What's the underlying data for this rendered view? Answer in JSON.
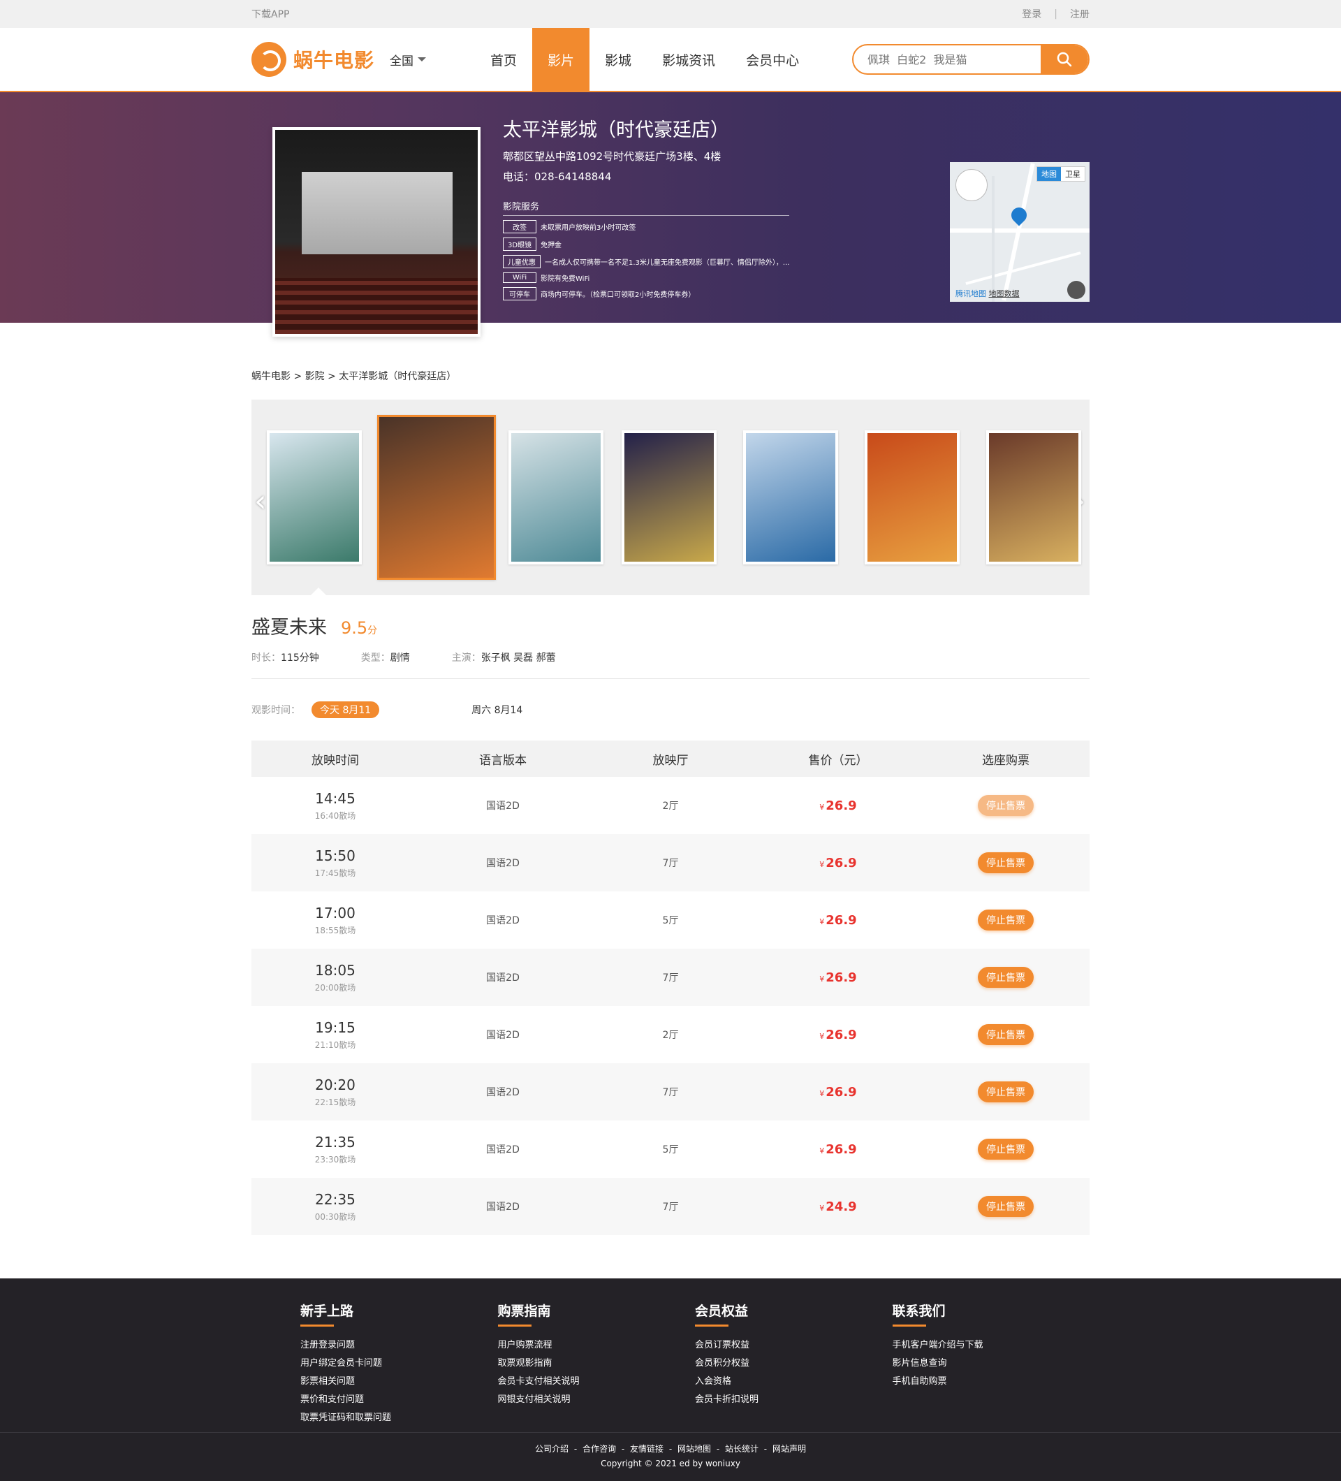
{
  "topbar": {
    "app": "下载APP",
    "login": "登录",
    "sep": "|",
    "register": "注册"
  },
  "header": {
    "logo": "蜗牛电影",
    "city": "全国",
    "nav": [
      "首页",
      "影片",
      "影城",
      "影城资讯",
      "会员中心"
    ],
    "nav_active": 1,
    "search_placeholder": "佩琪  白蛇2  我是猫"
  },
  "cinema": {
    "name": "太平洋影城（时代豪廷店）",
    "address": "郫都区望丛中路1092号时代豪廷广场3楼、4楼",
    "tel": "电话：028-64148844",
    "service_title": "影院服务",
    "services": [
      {
        "tag": "改签",
        "text": "未取票用户放映前3小时可改签"
      },
      {
        "tag": "3D眼镜",
        "text": "免押金"
      },
      {
        "tag": "儿童优惠",
        "text": "一名成人仅可携带一名不足1.3米儿童无座免费观影（巨幕厅、情侣厅除外），..."
      },
      {
        "tag": "WiFi",
        "text": "影院有免费WiFi"
      },
      {
        "tag": "可停车",
        "text": "商场内可停车。（检票口可领取2小时免费停车券）"
      }
    ],
    "map": {
      "tab_map": "地图",
      "tab_sat": "卫星",
      "brand": "腾讯地图",
      "data": "地图数据"
    }
  },
  "breadcrumb": "蜗牛电影 > 影院 > 太平洋影城（时代豪廷店）",
  "posters": {
    "count": 7,
    "selected": 1,
    "colors": [
      [
        "#d8e6ee",
        "#3b7a6a"
      ],
      [
        "#4a3328",
        "#e07a30"
      ],
      [
        "#d6e2e6",
        "#4e8a96"
      ],
      [
        "#23214a",
        "#c8a84a"
      ],
      [
        "#c2d6ea",
        "#2a6aa6"
      ],
      [
        "#c84a1a",
        "#e8a040"
      ],
      [
        "#6a3a2a",
        "#d8b060"
      ]
    ]
  },
  "movie": {
    "title": "盛夏未来",
    "score": "9.5",
    "score_unit": "分",
    "duration_label": "时长：",
    "duration": "115分钟",
    "genre_label": "类型：",
    "genre": "剧情",
    "cast_label": "主演：",
    "cast": "张子枫 吴磊 郝蕾"
  },
  "dates": {
    "label": "观影时间：",
    "today": "今天 8月11",
    "other": "周六 8月14"
  },
  "table": {
    "headers": [
      "放映时间",
      "语言版本",
      "放映厅",
      "售价（元）",
      "选座购票"
    ],
    "currency": "¥",
    "rows": [
      {
        "time": "14:45",
        "end": "16:40散场",
        "lang": "国语2D",
        "hall": "2厅",
        "price": "26.9",
        "action": "停止售票"
      },
      {
        "time": "15:50",
        "end": "17:45散场",
        "lang": "国语2D",
        "hall": "7厅",
        "price": "26.9",
        "action": "停止售票"
      },
      {
        "time": "17:00",
        "end": "18:55散场",
        "lang": "国语2D",
        "hall": "5厅",
        "price": "26.9",
        "action": "停止售票"
      },
      {
        "time": "18:05",
        "end": "20:00散场",
        "lang": "国语2D",
        "hall": "7厅",
        "price": "26.9",
        "action": "停止售票"
      },
      {
        "time": "19:15",
        "end": "21:10散场",
        "lang": "国语2D",
        "hall": "2厅",
        "price": "26.9",
        "action": "停止售票"
      },
      {
        "time": "20:20",
        "end": "22:15散场",
        "lang": "国语2D",
        "hall": "7厅",
        "price": "26.9",
        "action": "停止售票"
      },
      {
        "time": "21:35",
        "end": "23:30散场",
        "lang": "国语2D",
        "hall": "5厅",
        "price": "26.9",
        "action": "停止售票"
      },
      {
        "time": "22:35",
        "end": "00:30散场",
        "lang": "国语2D",
        "hall": "7厅",
        "price": "24.9",
        "action": "停止售票"
      }
    ]
  },
  "footer": {
    "cols": [
      {
        "title": "新手上路",
        "items": [
          "注册登录问题",
          "用户绑定会员卡问题",
          "影票相关问题",
          "票价和支付问题",
          "取票凭证码和取票问题"
        ]
      },
      {
        "title": "购票指南",
        "items": [
          "用户购票流程",
          "取票观影指南",
          "会员卡支付相关说明",
          "网银支付相关说明"
        ]
      },
      {
        "title": "会员权益",
        "items": [
          "会员订票权益",
          "会员积分权益",
          "入会资格",
          "会员卡折扣说明"
        ]
      },
      {
        "title": "联系我们",
        "items": [
          "手机客户端介绍与下载",
          "影片信息查询",
          "手机自助购票"
        ]
      }
    ],
    "links": [
      "公司介绍",
      "合作咨询",
      "友情链接",
      "网站地图",
      "站长统计",
      "网站声明"
    ],
    "copyright": "Copyright © 2021 ed by woniuxy"
  }
}
